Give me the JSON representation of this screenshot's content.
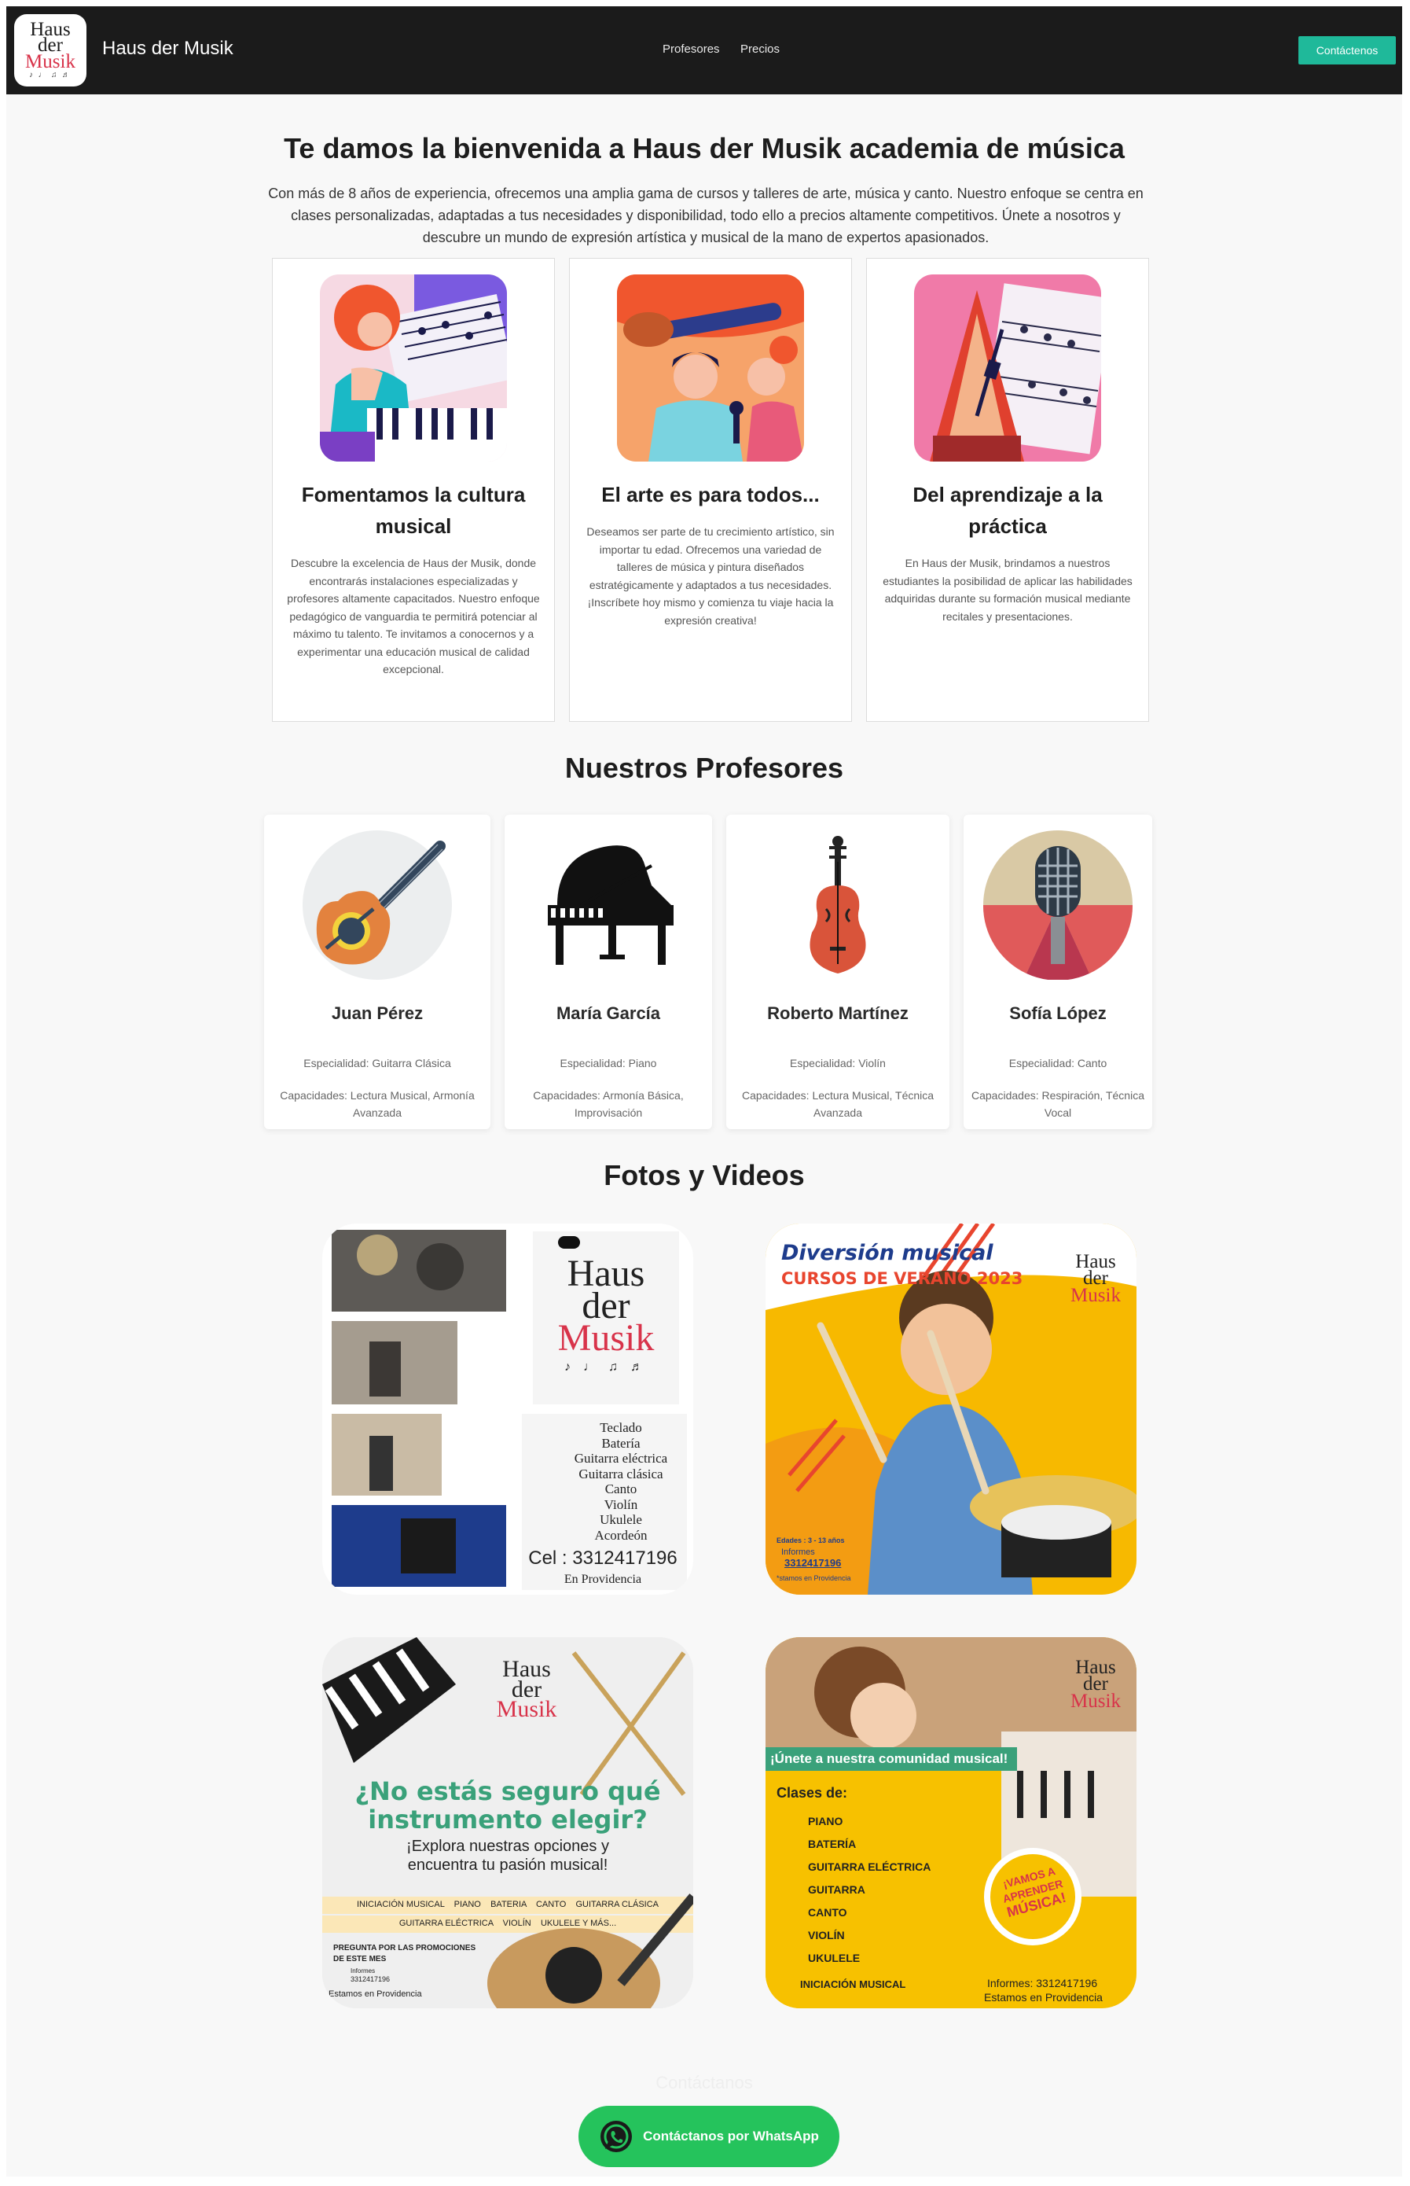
{
  "navbar": {
    "logo": {
      "line1": "Haus",
      "line2": "der",
      "line3": "Musik",
      "icons": "♪ ♩ ♫ ♬"
    },
    "brand": "Haus der Musik",
    "links": [
      "Profesores",
      "Precios"
    ],
    "cta": "Contáctenos"
  },
  "hero": {
    "title": "Te damos la bienvenida a Haus der Musik academia de música",
    "text": "Con más de 8 años de experiencia, ofrecemos una amplia gama de cursos y talleres de arte, música y canto. Nuestro enfoque se centra en clases personalizadas, adaptadas a tus necesidades y disponibilidad, todo ello a precios altamente competitivos. Únete a nosotros y descubre un mundo de expresión artística y musical de la mano de expertos apasionados."
  },
  "features": [
    {
      "title": "Fomentamos la cultura musical",
      "text": "Descubre la excelencia de Haus der Musik, donde encontrarás instalaciones especializadas y profesores altamente capacitados. Nuestro enfoque pedagógico de vanguardia te permitirá potenciar al máximo tu talento. Te invitamos a conocernos y a experimentar una educación musical de calidad excepcional."
    },
    {
      "title": "El arte es para todos...",
      "text": "Deseamos ser parte de tu crecimiento artístico, sin importar tu edad. Ofrecemos una variedad de talleres de música y pintura diseñados estratégicamente y adaptados a tus necesidades. ¡Inscríbete hoy mismo y comienza tu viaje hacia la expresión creativa!"
    },
    {
      "title": "Del aprendizaje a la práctica",
      "text": "En Haus der Musik, brindamos a nuestros estudiantes la posibilidad de aplicar las habilidades adquiridas durante su formación musical mediante recitales y presentaciones."
    }
  ],
  "teachers_title": "Nuestros Profesores",
  "teachers": [
    {
      "name": "Juan Pérez",
      "specialty": "Especialidad: Guitarra Clásica",
      "skills": "Capacidades: Lectura Musical, Armonía Avanzada"
    },
    {
      "name": "María García",
      "specialty": "Especialidad: Piano",
      "skills": "Capacidades: Armonía Básica, Improvisación"
    },
    {
      "name": "Roberto Martínez",
      "specialty": "Especialidad: Violín",
      "skills": "Capacidades: Lectura Musical, Técnica Avanzada"
    },
    {
      "name": "Sofía López",
      "specialty": "Especialidad: Canto",
      "skills": "Capacidades: Respiración, Técnica Vocal"
    }
  ],
  "gallery_title": "Fotos y Videos",
  "gallery": {
    "g1": {
      "logo": [
        "Haus",
        "der",
        "Musik"
      ],
      "courses": [
        "Teclado",
        "Batería",
        "Guitarra eléctrica",
        "Guitarra clásica",
        "Canto",
        "Violín",
        "Ukulele",
        "Acordeón"
      ],
      "phone": "Cel : 3312417196",
      "location": "En Providencia"
    },
    "g2": {
      "title": "Diversión musical",
      "subtitle": "CURSOS DE VERANO 2023",
      "logo": [
        "Haus",
        "der",
        "Musik"
      ],
      "ages": "Edades : 3 - 13 años",
      "info": "Informes",
      "phone": "3312417196",
      "location": "*stamos en Providencia"
    },
    "g3": {
      "logo": [
        "Haus",
        "der",
        "Musik"
      ],
      "headline1": "¿No estás seguro qué",
      "headline2": "instrumento elegir?",
      "sub1": "¡Explora nuestras opciones y",
      "sub2": "encuentra tu pasión musical!",
      "row1": "INICIACIÓN MUSICAL    PIANO    BATERIA    CANTO    GUITARRA CLÁSICA",
      "row2": "GUITARRA ELÉCTRICA    VIOLÍN    UKULELE Y MÁS...",
      "promo1": "PREGUNTA POR LAS PROMOCIONES",
      "promo2": "DE ESTE MES",
      "info": "Informes",
      "phone": "3312417196",
      "location": "Estamos en Providencia"
    },
    "g4": {
      "logo": [
        "Haus",
        "der",
        "Musik"
      ],
      "banner": "¡Únete a nuestra comunidad musical!",
      "classes_label": "Clases de:",
      "classes": [
        "PIANO",
        "BATERÍA",
        "GUITARRA ELÉCTRICA",
        "GUITARRA",
        "CANTO",
        "VIOLÍN",
        "UKULELE"
      ],
      "badge1": "¡VAMOS A",
      "badge2": "APRENDER",
      "badge3": "MÚSICA!",
      "initiation": "INICIACIÓN MUSICAL",
      "phone": "Informes:  3312417196",
      "location": "Estamos en Providencia"
    }
  },
  "footer": {
    "ghost": "Contáctanos",
    "whatsapp": "Contáctanos por WhatsApp"
  },
  "colors": {
    "nav_bg": "#1b1b1b",
    "accent": "#1fb99a",
    "whatsapp": "#25c35c",
    "brand_red": "#d8334a",
    "yellow": "#f7b900"
  }
}
